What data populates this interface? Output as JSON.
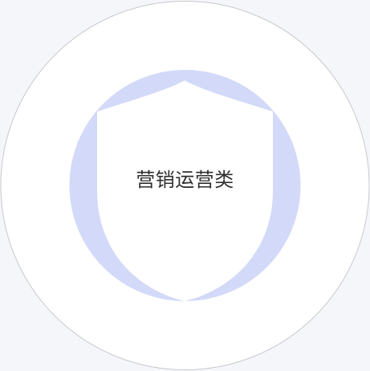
{
  "badge": {
    "label": "营销运营类",
    "icon": "shield-icon",
    "colors": {
      "background": "#f4f6fa",
      "outer_circle_fill": "#ffffff",
      "outer_circle_stroke": "#c9c9cc",
      "inner_circle_fill": "#d3d9f8",
      "shield_fill": "#ffffff",
      "label_color": "#2f2f2f"
    }
  }
}
